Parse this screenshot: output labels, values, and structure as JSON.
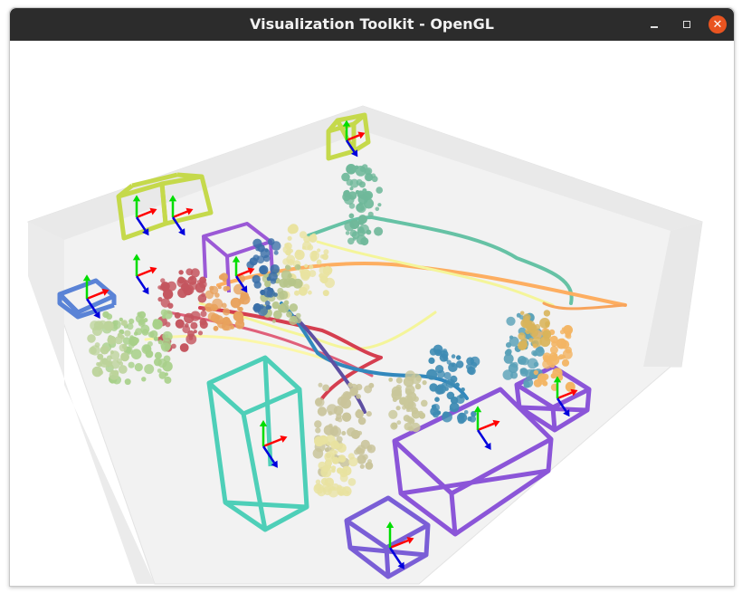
{
  "window": {
    "title": "Visualization Toolkit - OpenGL",
    "controls": {
      "minimize_icon": "minimize-icon",
      "maximize_icon": "maximize-icon",
      "close_icon": "close-icon",
      "close_color": "#e95420"
    }
  },
  "scene": {
    "renderer": "OpenGL",
    "floor_color": "#efefef",
    "axis_colors": {
      "x": "#ff0000",
      "y": "#00dd00",
      "z": "#0000dd"
    },
    "trajectory_colors": [
      "#66c2a5",
      "#fdae61",
      "#d53e4f",
      "#3288bd",
      "#f4f59a",
      "#5e4fa2"
    ],
    "box_colors": [
      "#c5d94b",
      "#4ecfb8",
      "#8b55d8",
      "#5a83d6",
      "#7a5ed6"
    ]
  }
}
